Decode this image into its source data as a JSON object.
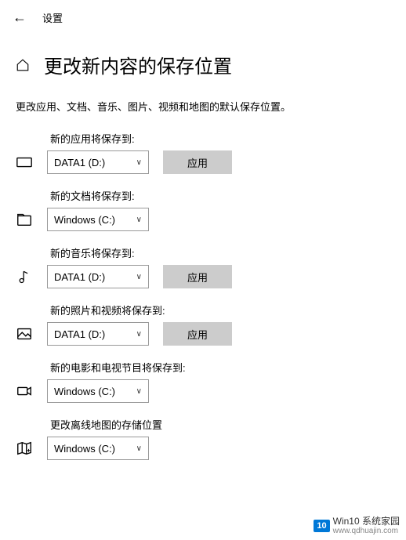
{
  "top": {
    "back": "←",
    "title": "设置"
  },
  "page": {
    "heading": "更改新内容的保存位置"
  },
  "description": "更改应用、文档、音乐、图片、视频和地图的默认保存位置。",
  "applyLabel": "应用",
  "sections": {
    "apps": {
      "label": "新的应用将保存到:",
      "value": "DATA1 (D:)",
      "showApply": true
    },
    "docs": {
      "label": "新的文档将保存到:",
      "value": "Windows (C:)",
      "showApply": false
    },
    "music": {
      "label": "新的音乐将保存到:",
      "value": "DATA1 (D:)",
      "showApply": true
    },
    "photos": {
      "label": "新的照片和视频将保存到:",
      "value": "DATA1 (D:)",
      "showApply": true
    },
    "movies": {
      "label": "新的电影和电视节目将保存到:",
      "value": "Windows (C:)",
      "showApply": false
    },
    "maps": {
      "label": "更改离线地图的存储位置",
      "value": "Windows (C:)",
      "showApply": false
    }
  },
  "watermark": {
    "logo": "10",
    "text": "Win10 系统家园",
    "url": "www.qdhuajin.com"
  }
}
